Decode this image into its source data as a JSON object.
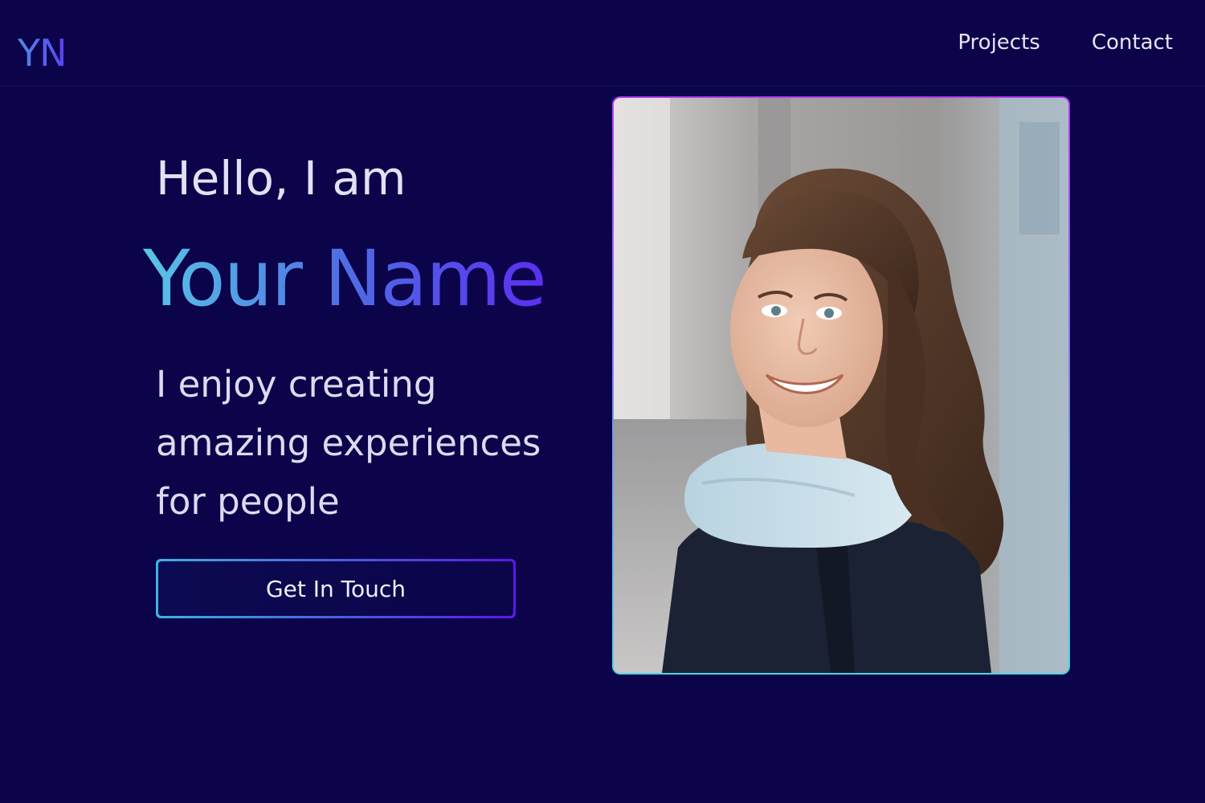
{
  "header": {
    "logo": "YN",
    "nav": [
      "Projects",
      "Contact"
    ]
  },
  "hero": {
    "greeting": "Hello, I am",
    "name": "Your Name",
    "tagline_lines": [
      "I enjoy creating",
      "amazing experiences",
      "for people"
    ],
    "cta_label": "Get In Touch"
  },
  "colors": {
    "background": "#0b044a",
    "gradient_start": "#58c6e6",
    "gradient_end": "#5b2ef0",
    "photo_border_top": "#b43cf0",
    "photo_border_bottom": "#4fd3e6"
  },
  "icons": {
    "portrait": "portrait-photo"
  }
}
